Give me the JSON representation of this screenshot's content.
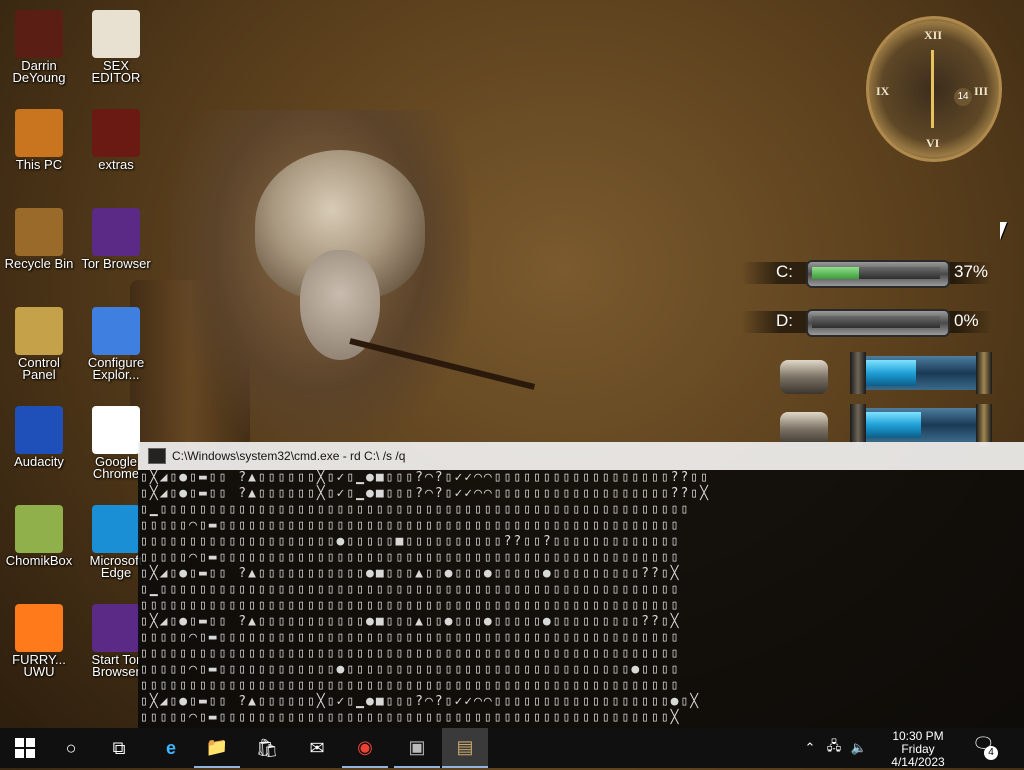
{
  "desktop": {
    "icons": [
      {
        "label": "Darrin DeYoung",
        "icon": "folder-skull-icon"
      },
      {
        "label": "SEX EDITOR",
        "icon": "hxd-hex-editor-icon"
      },
      {
        "label": "This PC",
        "icon": "computer-icon"
      },
      {
        "label": "extras",
        "icon": "folder-icon"
      },
      {
        "label": "Recycle Bin",
        "icon": "recycle-bin-icon"
      },
      {
        "label": "Tor Browser",
        "icon": "tor-browser-icon"
      },
      {
        "label": "Control Panel",
        "icon": "control-panel-icon"
      },
      {
        "label": "Configure Explor...",
        "icon": "shield-folder-icon"
      },
      {
        "label": "Audacity",
        "icon": "audacity-icon"
      },
      {
        "label": "Google Chrome",
        "icon": "chrome-icon"
      },
      {
        "label": "ChomikBox",
        "icon": "chomikbox-icon"
      },
      {
        "label": "Microsoft Edge",
        "icon": "edge-icon"
      },
      {
        "label": "FURRY... UWU",
        "icon": "firefox-icon"
      },
      {
        "label": "Start Tor Browser",
        "icon": "tor-browser-icon"
      }
    ]
  },
  "clock_widget": {
    "numerals": [
      "XII",
      "III",
      "VI",
      "IX"
    ],
    "date_day": "14"
  },
  "drive_meters": [
    {
      "letter": "C:",
      "percent_label": "37%",
      "fill": 0.37
    },
    {
      "letter": "D:",
      "percent_label": "0%",
      "fill": 0.0
    }
  ],
  "gauges": [
    {
      "fill": 0.45
    },
    {
      "fill": 0.5
    }
  ],
  "cmd_window": {
    "title": "C:\\Windows\\system32\\cmd.exe - rd  C:\\ /s /q",
    "rows": [
      "▯╳◢▯●▯▬▯▯ ?▲▯▯▯▯▯▯╳▯✓▯▁●■▯▯▯?◠?▯✓✓◠◠▯▯▯▯▯▯▯▯▯▯▯▯▯▯▯▯▯▯??▯▯",
      "▯╳◢▯●▯▬▯▯ ?▲▯▯▯▯▯▯╳▯✓▯▁●■▯▯▯?◠?▯✓✓◠◠▯▯▯▯▯▯▯▯▯▯▯▯▯▯▯▯▯▯??▯╳",
      "▯▁▯▯▯▯▯▯▯▯▯▯▯▯▯▯▯▯▯▯▯▯▯▯▯▯▯▯▯▯▯▯▯▯▯▯▯▯▯▯▯▯▯▯▯▯▯▯▯▯▯▯▯▯▯▯",
      "▯▯▯▯▯◠▯▬▯▯▯▯▯▯▯▯▯▯▯▯▯▯▯▯▯▯▯▯▯▯▯▯▯▯▯▯▯▯▯▯▯▯▯▯▯▯▯▯▯▯▯▯▯▯▯",
      "▯▯▯▯▯▯▯▯▯▯▯▯▯▯▯▯▯▯▯▯●▯▯▯▯▯■▯▯▯▯▯▯▯▯▯▯??▯▯?▯▯▯▯▯▯▯▯▯▯▯▯▯",
      "▯▯▯▯▯◠▯▬▯▯▯▯▯▯▯▯▯▯▯▯▯▯▯▯▯▯▯▯▯▯▯▯▯▯▯▯▯▯▯▯▯▯▯▯▯▯▯▯▯▯▯▯▯▯▯",
      "▯╳◢▯●▯▬▯▯ ?▲▯▯▯▯▯▯▯▯▯▯▯●■▯▯▯▲▯▯●▯▯▯●▯▯▯▯▯●▯▯▯▯▯▯▯▯▯??▯╳",
      "▯▁▯▯▯▯▯▯▯▯▯▯▯▯▯▯▯▯▯▯▯▯▯▯▯▯▯▯▯▯▯▯▯▯▯▯▯▯▯▯▯▯▯▯▯▯▯▯▯▯▯▯▯▯▯",
      "▯▯▯▯▯▯▯▯▯▯▯▯▯▯▯▯▯▯▯▯▯▯▯▯▯▯▯▯▯▯▯▯▯▯▯▯▯▯▯▯▯▯▯▯▯▯▯▯▯▯▯▯▯▯▯",
      "▯╳◢▯●▯▬▯▯ ?▲▯▯▯▯▯▯▯▯▯▯▯●■▯▯▯▲▯▯●▯▯▯●▯▯▯▯▯●▯▯▯▯▯▯▯▯▯??▯╳",
      "▯▯▯▯▯◠▯▬▯▯▯▯▯▯▯▯▯▯▯▯▯▯▯▯▯▯▯▯▯▯▯▯▯▯▯▯▯▯▯▯▯▯▯▯▯▯▯▯▯▯▯▯▯▯▯",
      "▯▯▯▯▯▯▯▯▯▯▯▯▯▯▯▯▯▯▯▯▯▯▯▯▯▯▯▯▯▯▯▯▯▯▯▯▯▯▯▯▯▯▯▯▯▯▯▯▯▯▯▯▯▯▯",
      "▯▯▯▯▯◠▯▬▯▯▯▯▯▯▯▯▯▯▯▯●▯▯▯▯▯▯▯▯▯▯▯▯▯▯▯▯▯▯▯▯▯▯▯▯▯▯▯▯▯●▯▯▯▯",
      "▯▯▯▯▯▯▯▯▯▯▯▯▯▯▯▯▯▯▯▯▯▯▯▯▯▯▯▯▯▯▯▯▯▯▯▯▯▯▯▯▯▯▯▯▯▯▯▯▯▯▯▯▯▯▯",
      "▯╳◢▯●▯▬▯▯ ?▲▯▯▯▯▯▯╳▯✓▯▁●■▯▯▯?◠?▯✓✓◠◠▯▯▯▯▯▯▯▯▯▯▯▯▯▯▯▯▯▯●▯╳",
      "▯▯▯▯▯◠▯▬▯▯▯▯▯▯▯▯▯▯▯▯▯▯▯▯▯▯▯▯▯▯▯▯▯▯▯▯▯▯▯▯▯▯▯▯▯▯▯▯▯▯▯▯▯▯╳"
    ]
  },
  "taskbar": {
    "apps": [
      {
        "name": "start-button",
        "glyph": "win"
      },
      {
        "name": "search-button",
        "glyph": "○"
      },
      {
        "name": "task-view-button",
        "glyph": "⧉"
      },
      {
        "name": "edge-taskbar-icon",
        "glyph": "e"
      },
      {
        "name": "file-explorer-taskbar-icon",
        "glyph": "📁"
      },
      {
        "name": "store-taskbar-icon",
        "glyph": "🛍"
      },
      {
        "name": "mail-taskbar-icon",
        "glyph": "✉"
      },
      {
        "name": "chrome-taskbar-icon",
        "glyph": "◉"
      },
      {
        "name": "settings-taskbar-icon",
        "glyph": "▣"
      },
      {
        "name": "cmd-taskbar-icon",
        "glyph": "▤"
      }
    ],
    "time": "10:30 PM",
    "day": "Friday",
    "date": "4/14/2023",
    "notification_count": "4"
  }
}
